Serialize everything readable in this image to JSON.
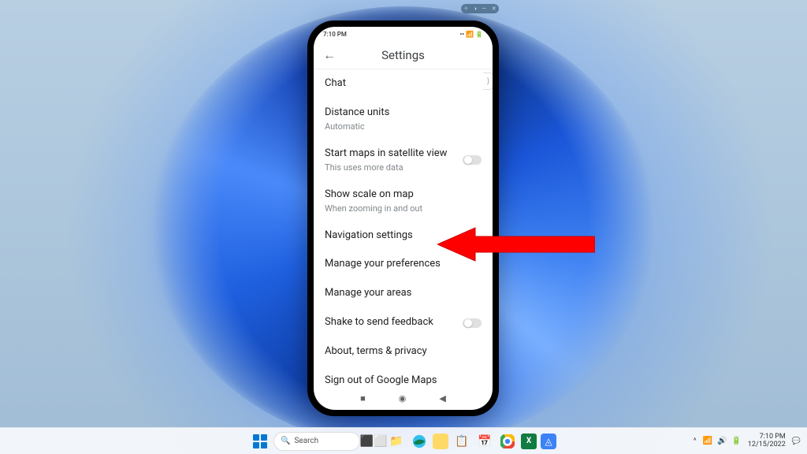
{
  "desktop": {
    "taskbar": {
      "search_placeholder": "Search",
      "time": "7:10 PM",
      "date": "12/15/2022"
    },
    "float_toolbar": [
      "✧",
      "◑",
      "—",
      "✕"
    ]
  },
  "phone": {
    "status": {
      "time": "7:10 PM",
      "icons_left": "⏰ ■",
      "icons_right": "📶 📶 🔋"
    },
    "header": {
      "title": "Settings"
    },
    "settings": [
      {
        "title": "Chat",
        "sub": "",
        "toggle": false
      },
      {
        "title": "Distance units",
        "sub": "Automatic",
        "toggle": false
      },
      {
        "title": "Start maps in satellite view",
        "sub": "This uses more data",
        "toggle": true
      },
      {
        "title": "Show scale on map",
        "sub": "When zooming in and out",
        "toggle": false
      },
      {
        "title": "Navigation settings",
        "sub": "",
        "toggle": false
      },
      {
        "title": "Manage your preferences",
        "sub": "",
        "toggle": false
      },
      {
        "title": "Manage your areas",
        "sub": "",
        "toggle": false
      },
      {
        "title": "Shake to send feedback",
        "sub": "",
        "toggle": true
      },
      {
        "title": "About, terms & privacy",
        "sub": "",
        "toggle": false
      },
      {
        "title": "Sign out of Google Maps",
        "sub": "",
        "toggle": false
      }
    ],
    "side_tab": "⟩"
  }
}
